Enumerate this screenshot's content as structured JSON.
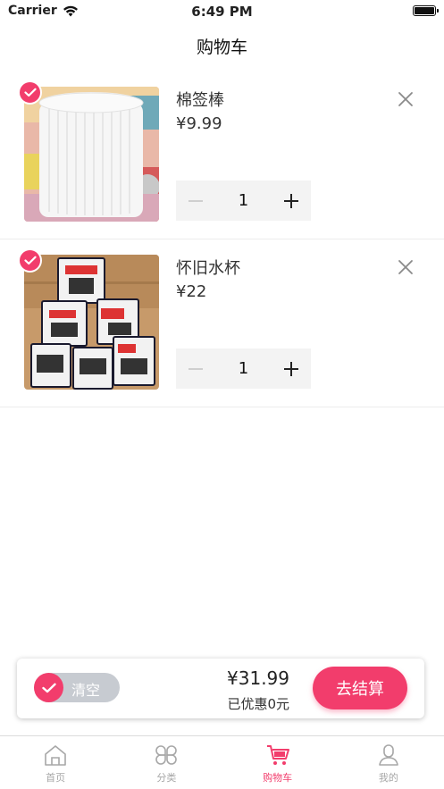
{
  "status": {
    "carrier": "Carrier",
    "time": "6:49 PM"
  },
  "nav": {
    "title": "购物车"
  },
  "items": [
    {
      "name": "棉签棒",
      "price": "¥9.99",
      "quantity": "1",
      "checked": true
    },
    {
      "name": "怀旧水杯",
      "price": "¥22",
      "quantity": "1",
      "checked": true
    }
  ],
  "summary": {
    "clear_label": "清空",
    "total": "¥31.99",
    "discount": "已优惠0元",
    "checkout_label": "去结算"
  },
  "tabs": [
    {
      "label": "首页",
      "icon": "home-icon",
      "active": false
    },
    {
      "label": "分类",
      "icon": "category-icon",
      "active": false
    },
    {
      "label": "购物车",
      "icon": "cart-icon",
      "active": true
    },
    {
      "label": "我的",
      "icon": "profile-icon",
      "active": false
    }
  ],
  "colors": {
    "accent": "#f23d6c",
    "muted": "#a7a7a7",
    "pill": "#c7cbd1"
  }
}
